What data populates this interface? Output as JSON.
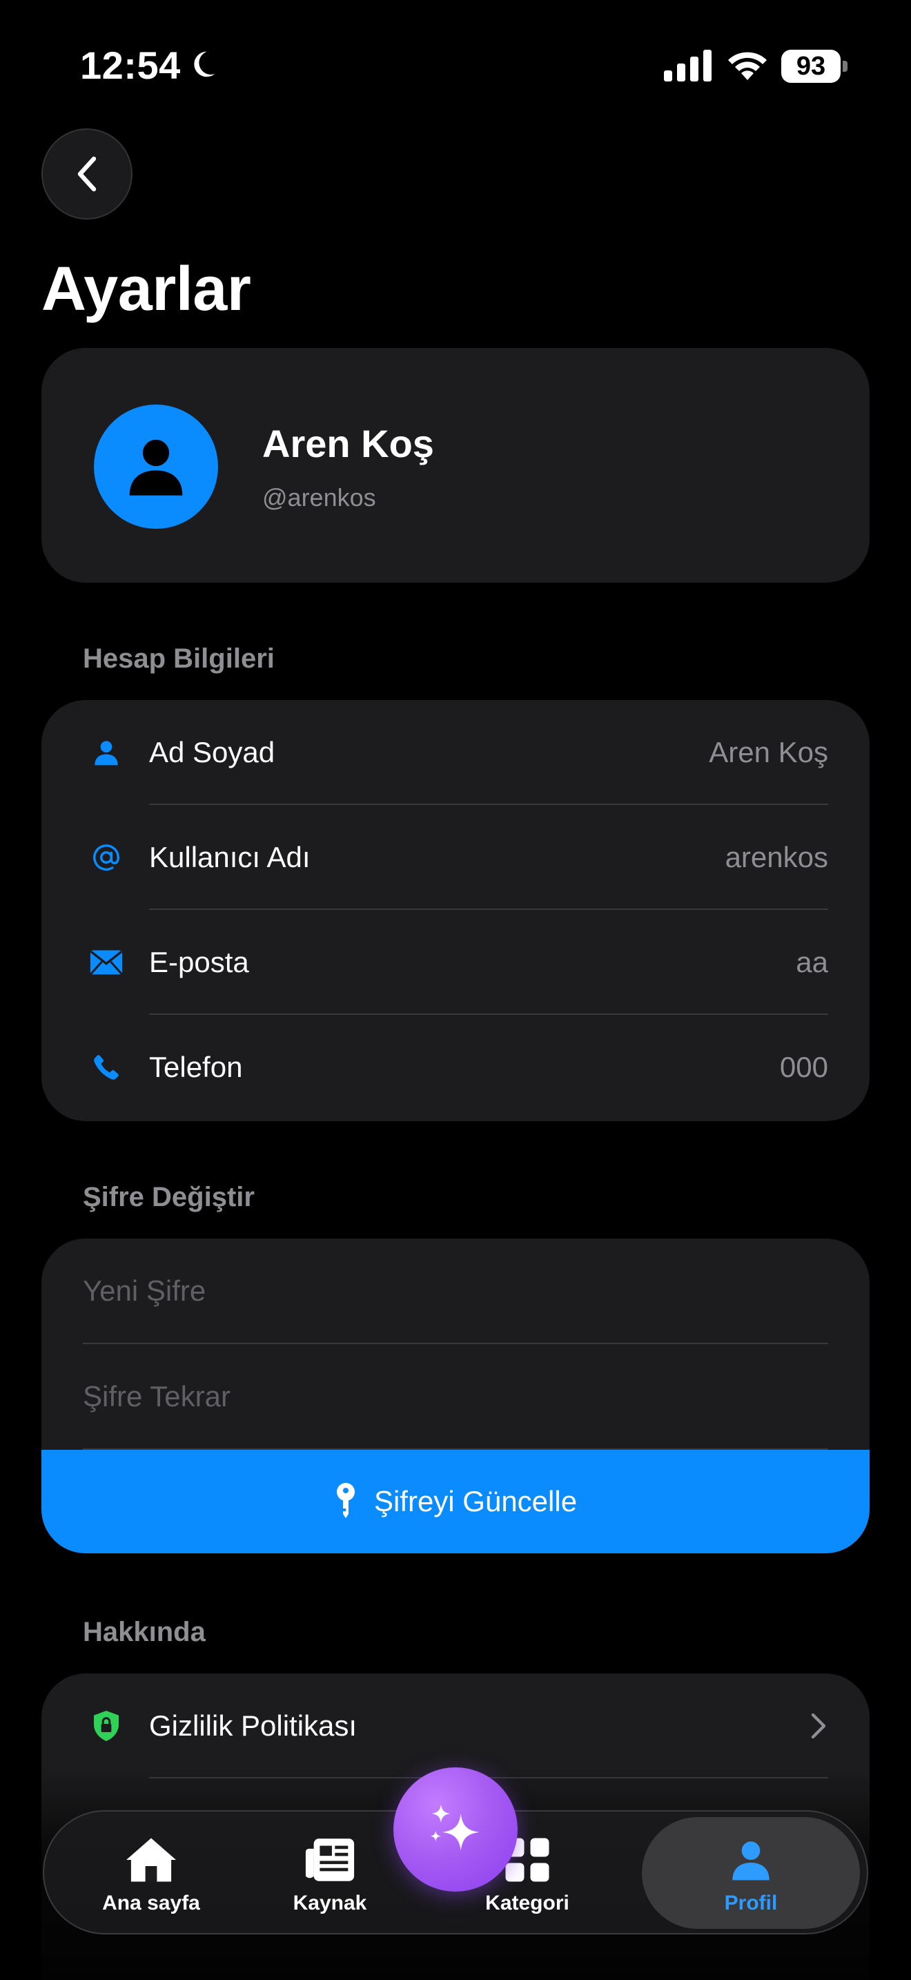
{
  "status_bar": {
    "time": "12:54",
    "battery": "93"
  },
  "page": {
    "title": "Ayarlar"
  },
  "profile": {
    "name": "Aren Koş",
    "username": "@arenkos"
  },
  "account": {
    "header": "Hesap Bilgileri",
    "rows": [
      {
        "label": "Ad Soyad",
        "value": "Aren Koş",
        "icon": "person-icon"
      },
      {
        "label": "Kullanıcı Adı",
        "value": "arenkos",
        "icon": "at-icon"
      },
      {
        "label": "E-posta",
        "value": "aa",
        "icon": "envelope-icon"
      },
      {
        "label": "Telefon",
        "value": "000",
        "icon": "phone-icon"
      }
    ]
  },
  "password": {
    "header": "Şifre Değiştir",
    "new_placeholder": "Yeni Şifre",
    "repeat_placeholder": "Şifre Tekrar",
    "button_label": "Şifreyi Güncelle"
  },
  "about": {
    "header": "Hakkında",
    "rows": [
      {
        "label": "Gizlilik Politikası",
        "icon": "shield-lock-icon"
      }
    ]
  },
  "tabs": [
    {
      "label": "Ana sayfa",
      "icon": "home-icon"
    },
    {
      "label": "Kaynak",
      "icon": "newspaper-icon"
    },
    {
      "label": "Kategori",
      "icon": "grid-icon"
    },
    {
      "label": "Profil",
      "icon": "person-icon",
      "active": true
    }
  ],
  "colors": {
    "accent": "#0a8cff",
    "card": "#1c1c1e",
    "background": "#000000",
    "secondary_text": "#8e8e93",
    "ai_button": "#a75cf2",
    "privacy_icon": "#30d158"
  }
}
